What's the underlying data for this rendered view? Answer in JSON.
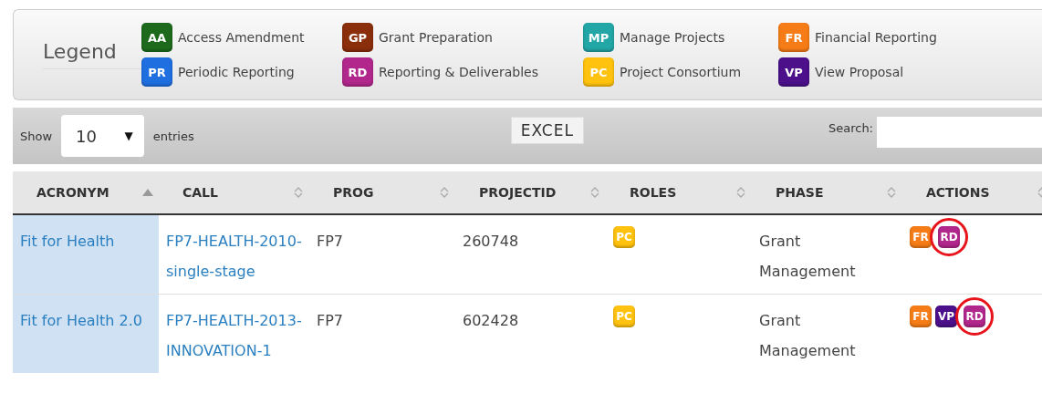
{
  "legend": {
    "title": "Legend",
    "items": [
      {
        "code": "AA",
        "label": "Access Amendment",
        "color": "#1d6a1d"
      },
      {
        "code": "GP",
        "label": "Grant Preparation",
        "color": "#8a2e0c"
      },
      {
        "code": "MP",
        "label": "Manage Projects",
        "color": "#23a6a6"
      },
      {
        "code": "FR",
        "label": "Financial Reporting",
        "color": "#f57c16"
      },
      {
        "code": "PR",
        "label": "Periodic Reporting",
        "color": "#1f6fe0"
      },
      {
        "code": "RD",
        "label": "Reporting & Deliverables",
        "color": "#b1278c"
      },
      {
        "code": "PC",
        "label": "Project Consortium",
        "color": "#ffc20e"
      },
      {
        "code": "VP",
        "label": "View Proposal",
        "color": "#4b108a"
      }
    ]
  },
  "toolbar": {
    "show_label": "Show",
    "page_size": "10",
    "caret": "▼",
    "entries_label": "entries",
    "excel_button": "EXCEL",
    "search_label": "Search:"
  },
  "table": {
    "columns": [
      {
        "label": "ACRONYM",
        "sorted": true
      },
      {
        "label": "CALL",
        "sorted": false
      },
      {
        "label": "PROG",
        "sorted": false
      },
      {
        "label": "PROJECTID",
        "sorted": false
      },
      {
        "label": "ROLES",
        "sorted": false
      },
      {
        "label": "PHASE",
        "sorted": false
      },
      {
        "label": "ACTIONS",
        "sorted": false
      }
    ],
    "rows": [
      {
        "acronym": "Fit for Health",
        "call": "FP7-HEALTH-2010-single-stage",
        "prog": "FP7",
        "projectid": "260748",
        "roles": [
          {
            "code": "PC",
            "color": "#ffc20e"
          }
        ],
        "phase": "Grant Management",
        "actions": [
          {
            "code": "FR",
            "color": "#f57c16",
            "circled": false
          },
          {
            "code": "RD",
            "color": "#b1278c",
            "circled": true
          }
        ]
      },
      {
        "acronym": "Fit for Health 2.0",
        "call": "FP7-HEALTH-2013-INNOVATION-1",
        "prog": "FP7",
        "projectid": "602428",
        "roles": [
          {
            "code": "PC",
            "color": "#ffc20e"
          }
        ],
        "phase": "Grant Management",
        "actions": [
          {
            "code": "FR",
            "color": "#f57c16",
            "circled": false
          },
          {
            "code": "VP",
            "color": "#4b108a",
            "circled": false
          },
          {
            "code": "RD",
            "color": "#b1278c",
            "circled": true
          }
        ]
      }
    ]
  }
}
